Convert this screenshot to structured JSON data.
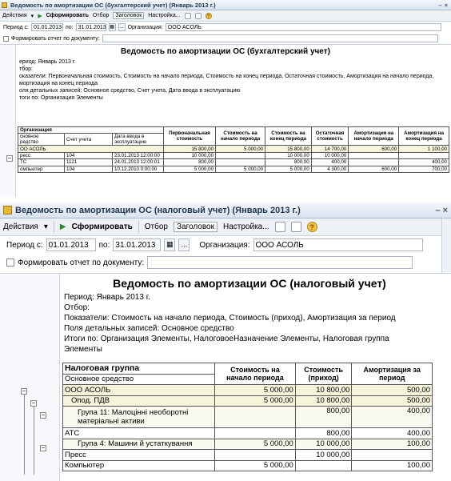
{
  "w1": {
    "title": "Ведомость по амортизации ОС (бухгалтерский учет) (Январь 2013 г.)",
    "toolbar": {
      "actions": "Действия",
      "generate": "Сформировать",
      "selection": "Отбор",
      "heading": "Заголовок",
      "settings": "Настройка..."
    },
    "period": {
      "label_from": "Период с:",
      "from": "01.01.2013",
      "label_to": "по:",
      "to": "31.01.2013",
      "ellipsis": "...",
      "org_label": "Организация:",
      "org": "ООО АСОЛЬ"
    },
    "by_doc": "Формировать отчет по документу:",
    "report": {
      "title": "Ведомость по амортизации ОС (бухгалтерский учет)",
      "period": "ериод: Январь 2013 г.",
      "selection": "тбор:",
      "indicators": "оказатели: Первоначальная стоимость, Стоимость на начало периода, Стоимость на конец периода, Остаточная стоимость, Амортизация на начало периода,",
      "indicators2": "мортизация на конец периода",
      "detail": "оля детальных записей: Основное средство, Счет учета, Дата ввода в эксплуатацию",
      "totals": "тоги по: Организация Элементы",
      "cols": {
        "org": "Организация",
        "asset": "сновное\nредство",
        "account": "Счет учета",
        "date": "Дата ввода в\nэксплуатацию",
        "initial": "Первоначальная\nстоимость",
        "start": "Стоимость на\nначало периода",
        "end": "Стоимость на\nконец периода",
        "residual": "Остаточная\nстоимость",
        "amort_start": "Амортизация на\nначало периода",
        "amort_end": "Амортизация на\nконец периода"
      },
      "rows": [
        {
          "name": "ОО АСОЛЬ",
          "account": "",
          "date": "",
          "initial": "15 800,00",
          "start": "5 000,00",
          "end": "15 800,00",
          "residual": "14 700,00",
          "amort_start": "600,00",
          "amort_end": "1 100,00"
        },
        {
          "name": "ресс",
          "account": "104",
          "date": "23.01.2013 12:00:00",
          "initial": "10 000,00",
          "start": "",
          "end": "10 000,00",
          "residual": "10 000,00",
          "amort_start": "",
          "amort_end": ""
        },
        {
          "name": "ТС",
          "account": "1121",
          "date": "24.01.2013 12:00:01",
          "initial": "800,00",
          "start": "",
          "end": "800,00",
          "residual": "400,00",
          "amort_start": "",
          "amort_end": "400,00"
        },
        {
          "name": "омпьютер",
          "account": "104",
          "date": "10.12.2010 0:00:00",
          "initial": "5 000,00",
          "start": "5 000,00",
          "end": "5 000,00",
          "residual": "4 300,00",
          "amort_start": "600,00",
          "amort_end": "700,00"
        }
      ]
    }
  },
  "w2": {
    "title": "Ведомость по амортизации ОС (налоговый учет) (Январь 2013 г.)",
    "toolbar": {
      "actions": "Действия",
      "generate": "Сформировать",
      "selection": "Отбор",
      "heading": "Заголовок",
      "settings": "Настройка..."
    },
    "period": {
      "label_from": "Период с:",
      "from": "01.01.2013",
      "label_to": "по:",
      "to": "31.01.2013",
      "ellipsis": "...",
      "org_label": "Организация:",
      "org": "ООО АСОЛЬ"
    },
    "by_doc": "Формировать отчет по документу:",
    "report": {
      "title": "Ведомость по амортизации ОС (налоговый учет)",
      "period": "Период: Январь 2013 г.",
      "selection": "Отбор:",
      "indicators": "Показатели: Стоимость на начало периода, Стоимость (приход), Амортизация за период",
      "detail": "Поля детальных записей: Основное средство",
      "totals": "Итоги по: Организация Элементы, НалоговоеНазначение Элементы, Налоговая группа",
      "totals2": "Элементы",
      "cols": {
        "group": "Налоговая группа",
        "asset": "Основное средство",
        "start": "Стоимость на\nначало периода",
        "income": "Стоимость\n(приход)",
        "amort": "Амортизация за\nпериод"
      },
      "rows": [
        {
          "name": "ООО АСОЛЬ",
          "start": "5 000,00",
          "income": "10 800,00",
          "amort": "500,00"
        },
        {
          "name": "Опод. ПДВ",
          "start": "5 000,00",
          "income": "10 800,00",
          "amort": "500,00"
        },
        {
          "name": "Група 11: Малоцінні необоротні\nматеріальні активи",
          "start": "",
          "income": "800,00",
          "amort": "400,00"
        },
        {
          "name": "АТС",
          "start": "",
          "income": "800,00",
          "amort": "400,00"
        },
        {
          "name": "Група 4: Машини й устаткування",
          "start": "5 000,00",
          "income": "10 000,00",
          "amort": "100,00"
        },
        {
          "name": "Пресс",
          "start": "",
          "income": "10 000,00",
          "amort": ""
        },
        {
          "name": "Компьютер",
          "start": "5 000,00",
          "income": "",
          "amort": "100,00"
        }
      ]
    }
  }
}
